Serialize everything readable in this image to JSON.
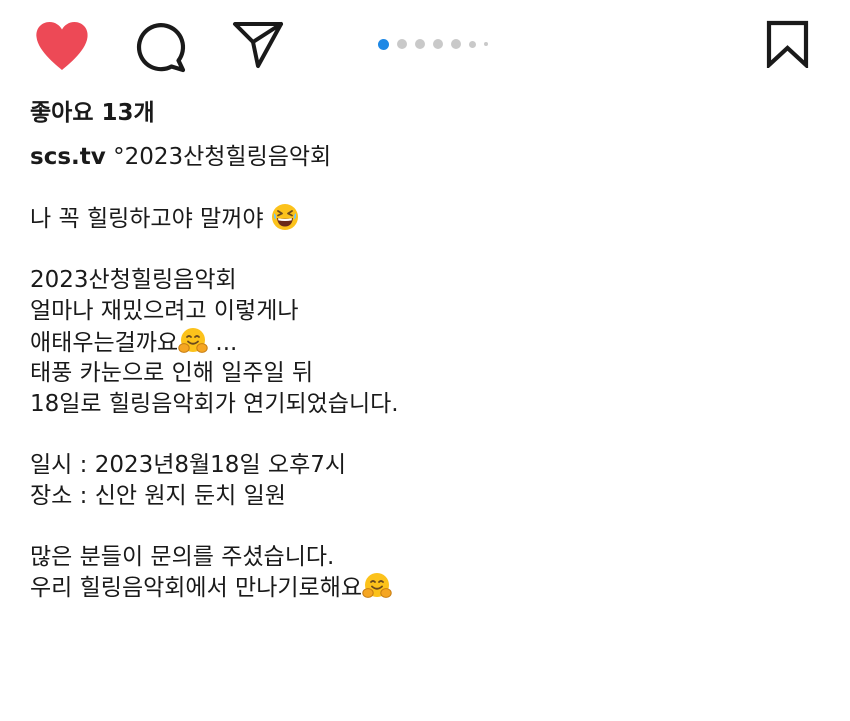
{
  "actions": {
    "like_icon": "heart-filled-icon",
    "comment_icon": "comment-bubble-icon",
    "share_icon": "paper-plane-icon",
    "save_icon": "bookmark-icon",
    "like_color": "#ed4956"
  },
  "carousel": {
    "total_dots": 7,
    "active_index": 0,
    "active_color": "#1e88e5"
  },
  "likes": {
    "text": "좋아요 13개"
  },
  "post": {
    "username": "scs.tv",
    "caption_lines": [
      "°2023산청힐링음악회",
      "",
      "나 꼭 힐링하고야 말꺼야",
      "",
      "2023산청힐링음악회",
      "얼마나 재밌으려고 이렇게나",
      "애태우는걸까요",
      "태풍 카눈으로 인해 일주일 뒤",
      "18일로 힐링음악회가 연기되었습니다.",
      "",
      "일시 : 2023년8월18일 오후7시",
      "장소 : 신안 원지 둔치 일원",
      "",
      "많은 분들이 문의를 주셨습니다.",
      "우리 힐링음악회에서 만나기로해요"
    ],
    "line7_suffix": " ...",
    "emoji": {
      "laughing": "grinning-squinting-face-emoji",
      "hugging": "hugging-face-emoji"
    }
  }
}
